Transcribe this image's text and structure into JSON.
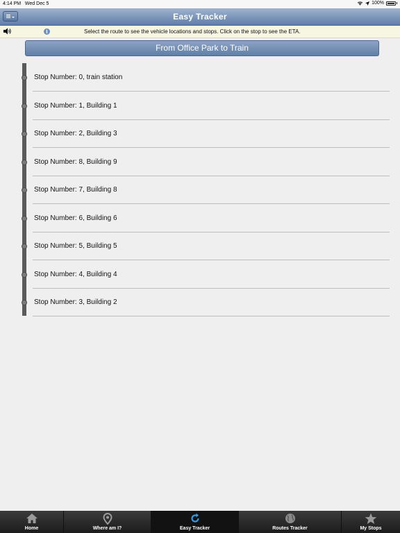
{
  "status_bar": {
    "time": "4:14 PM",
    "date": "Wed Dec 5",
    "battery": "100%"
  },
  "nav": {
    "title": "Easy Tracker"
  },
  "info": {
    "message": "Select the route to see the vehicle locations and stops. Click on the stop to see the ETA."
  },
  "route": {
    "label": "From Office Park to Train"
  },
  "stops": [
    "Stop Number: 0, train station",
    "Stop Number: 1, Building 1",
    "Stop Number: 2, Building 3",
    "Stop Number: 8, Building 9",
    "Stop Number: 7, Building 8",
    "Stop Number: 6, Building 6",
    "Stop Number: 5, Building 5",
    "Stop Number: 4, Building 4",
    "Stop Number: 3, Building 2"
  ],
  "tabs": [
    {
      "label": "Home",
      "icon": "home-icon"
    },
    {
      "label": "Where am I?",
      "icon": "location-pin-icon"
    },
    {
      "label": "Easy Tracker",
      "icon": "refresh-icon",
      "active": true
    },
    {
      "label": "Routes Tracker",
      "icon": "globe-icon"
    },
    {
      "label": "My Stops",
      "icon": "star-icon"
    }
  ],
  "colors": {
    "nav_accent": "#5f7ea8",
    "active_tab_icon": "#2e9be6"
  }
}
